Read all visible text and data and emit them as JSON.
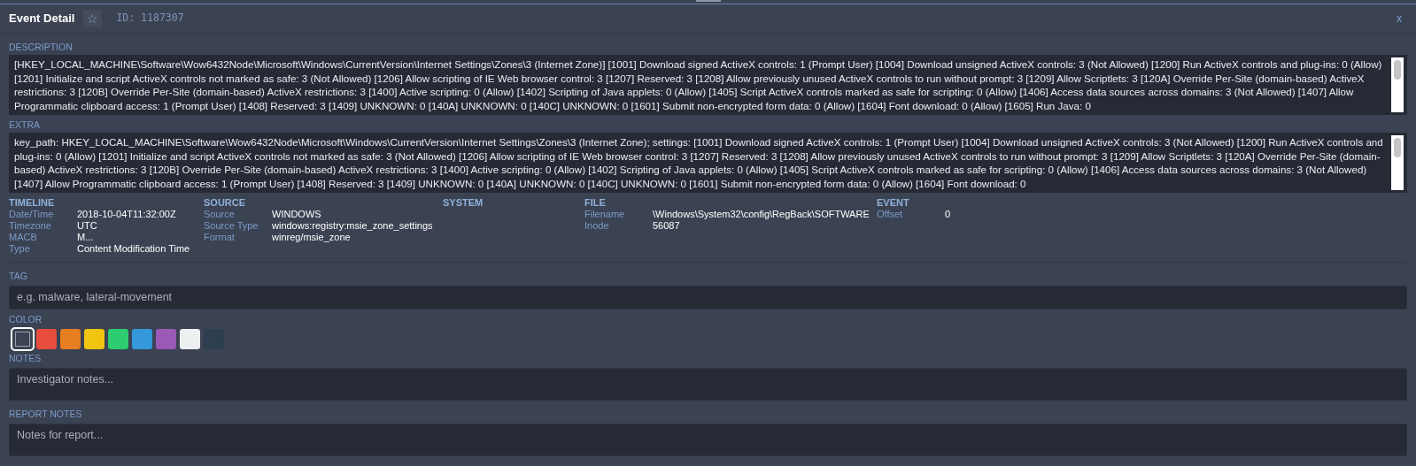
{
  "header": {
    "title": "Event Detail",
    "star": "☆",
    "id": "ID: 1187307",
    "close": "x"
  },
  "description": {
    "label": "DESCRIPTION",
    "text": "[HKEY_LOCAL_MACHINE\\Software\\Wow6432Node\\Microsoft\\Windows\\CurrentVersion\\Internet Settings\\Zones\\3 (Internet Zone)] [1001] Download signed ActiveX controls: 1 (Prompt User) [1004] Download unsigned ActiveX controls: 3 (Not Allowed) [1200] Run ActiveX controls and plug-ins: 0 (Allow) [1201] Initialize and script ActiveX controls not marked as safe: 3 (Not Allowed) [1206] Allow scripting of IE Web browser control: 3 [1207] Reserved: 3 [1208] Allow previously unused ActiveX controls to run without prompt: 3 [1209] Allow Scriptlets: 3 [120A] Override Per-Site (domain-based) ActiveX restrictions: 3 [120B] Override Per-Site (domain-based) ActiveX restrictions: 3 [1400] Active scripting: 0 (Allow) [1402] Scripting of Java applets: 0 (Allow) [1405] Script ActiveX controls marked as safe for scripting: 0 (Allow) [1406] Access data sources across domains: 3 (Not Allowed) [1407] Allow Programmatic clipboard access: 1 (Prompt User) [1408] Reserved: 3 [1409] UNKNOWN: 0 [140A] UNKNOWN: 0 [140C] UNKNOWN: 0 [1601] Submit non-encrypted form data: 0 (Allow) [1604] Font download: 0 (Allow) [1605] Run Java: 0"
  },
  "extra": {
    "label": "EXTRA",
    "text": "key_path: HKEY_LOCAL_MACHINE\\Software\\Wow6432Node\\Microsoft\\Windows\\CurrentVersion\\Internet Settings\\Zones\\3 (Internet Zone); settings: [1001] Download signed ActiveX controls: 1 (Prompt User) [1004] Download unsigned ActiveX controls: 3 (Not Allowed) [1200] Run ActiveX controls and plug-ins: 0 (Allow) [1201] Initialize and script ActiveX controls not marked as safe: 3 (Not Allowed) [1206] Allow scripting of IE Web browser control: 3 [1207] Reserved: 3 [1208] Allow previously unused ActiveX controls to run without prompt: 3 [1209] Allow Scriptlets: 3 [120A] Override Per-Site (domain-based) ActiveX restrictions: 3 [120B] Override Per-Site (domain-based) ActiveX restrictions: 3 [1400] Active scripting: 0 (Allow) [1402] Scripting of Java applets: 0 (Allow) [1405] Script ActiveX controls marked as safe for scripting: 0 (Allow) [1406] Access data sources across domains: 3 (Not Allowed) [1407] Allow Programmatic clipboard access: 1 (Prompt User) [1408] Reserved: 3 [1409] UNKNOWN: 0 [140A] UNKNOWN: 0 [140C] UNKNOWN: 0 [1601] Submit non-encrypted form data: 0 (Allow) [1604] Font download: 0"
  },
  "sections": [
    {
      "title": "TIMELINE",
      "fields": [
        {
          "label": "Date/Time",
          "value": "2018-10-04T11:32:00Z"
        },
        {
          "label": "Timezone",
          "value": "UTC"
        },
        {
          "label": "MACB",
          "value": "M..."
        },
        {
          "label": "Type",
          "value": "Content Modification Time"
        }
      ]
    },
    {
      "title": "SOURCE",
      "fields": [
        {
          "label": "Source",
          "value": "WINDOWS"
        },
        {
          "label": "Source Type",
          "value": "windows:registry:msie_zone_settings"
        },
        {
          "label": "Format",
          "value": "winreg/msie_zone"
        }
      ]
    },
    {
      "title": "SYSTEM"
    },
    {
      "title": "FILE",
      "fields": [
        {
          "label": "Filename",
          "value": "\\Windows\\System32\\config\\RegBack\\SOFTWARE"
        },
        {
          "label": "Inode",
          "value": "56087"
        }
      ]
    },
    {
      "title": "EVENT",
      "fields": [
        {
          "label": "Offset",
          "value": "0"
        }
      ]
    }
  ],
  "tag": {
    "label": "TAG",
    "placeholder": "e.g. malware, lateral-movement"
  },
  "color": {
    "label": "COLOR",
    "swatches": [
      {
        "kind": "none",
        "color": "#3b4252",
        "selected": true
      },
      {
        "kind": "color",
        "color": "#e74c3c",
        "selected": false
      },
      {
        "kind": "color",
        "color": "#e67e22",
        "selected": false
      },
      {
        "kind": "color",
        "color": "#f1c40f",
        "selected": false
      },
      {
        "kind": "color",
        "color": "#2ecc71",
        "selected": false
      },
      {
        "kind": "color",
        "color": "#3498db",
        "selected": false
      },
      {
        "kind": "color",
        "color": "#9b59b6",
        "selected": false
      },
      {
        "kind": "color",
        "color": "#ecf0f1",
        "selected": false
      },
      {
        "kind": "color",
        "color": "#2c3e50",
        "selected": false
      }
    ]
  },
  "notes": {
    "label": "NOTES",
    "placeholder": "Investigator notes..."
  },
  "report_notes": {
    "label": "REPORT NOTES",
    "placeholder": "Notes for report..."
  }
}
